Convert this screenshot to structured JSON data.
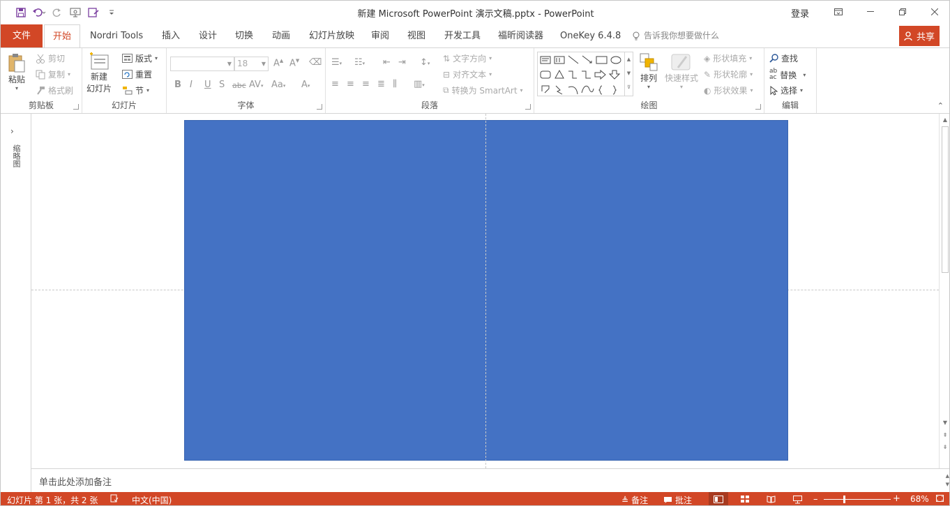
{
  "window": {
    "title": "新建 Microsoft PowerPoint 演示文稿.pptx  -  PowerPoint",
    "login": "登录"
  },
  "tabs": {
    "file": "文件",
    "items": [
      "开始",
      "Nordri Tools",
      "插入",
      "设计",
      "切换",
      "动画",
      "幻灯片放映",
      "审阅",
      "视图",
      "开发工具",
      "福昕阅读器",
      "OneKey 6.4.8"
    ],
    "tellme": "告诉我你想要做什么",
    "share": "共享"
  },
  "ribbon": {
    "clipboard": {
      "label": "剪贴板",
      "paste": "粘贴",
      "cut": "剪切",
      "copy": "复制",
      "painter": "格式刷"
    },
    "slides": {
      "label": "幻灯片",
      "new_line1": "新建",
      "new_line2": "幻灯片",
      "layout": "版式",
      "reset": "重置",
      "section": "节"
    },
    "font": {
      "label": "字体",
      "size": "18"
    },
    "paragraph": {
      "label": "段落",
      "direction": "文字方向",
      "align_text": "对齐文本",
      "smartart": "转换为 SmartArt"
    },
    "drawing": {
      "label": "绘图",
      "arrange": "排列",
      "quick_styles": "快速样式",
      "fill": "形状填充",
      "outline": "形状轮廓",
      "effects": "形状效果"
    },
    "editing": {
      "label": "编辑",
      "find": "查找",
      "replace": "替换",
      "select": "选择"
    }
  },
  "leftpane": {
    "label": "缩略图"
  },
  "notes": {
    "placeholder": "单击此处添加备注"
  },
  "status": {
    "slide_info": "幻灯片 第 1 张，共 2 张",
    "language": "中文(中国)",
    "notes": "备注",
    "comments": "批注",
    "zoom": "68%"
  },
  "colors": {
    "accent": "#d24726",
    "slide_fill": "#4472c4"
  }
}
